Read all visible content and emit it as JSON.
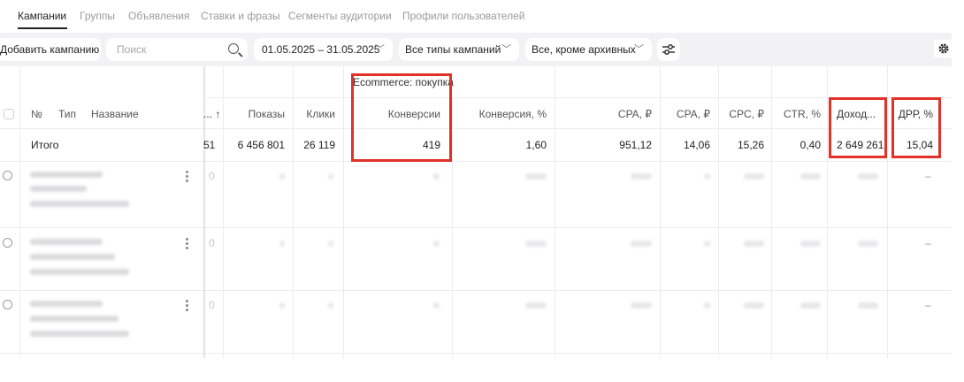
{
  "tabs": [
    {
      "label": "Кампании",
      "active": true
    },
    {
      "label": "Группы",
      "active": false
    },
    {
      "label": "Объявления",
      "active": false
    },
    {
      "label": "Ставки и фразы",
      "active": false
    },
    {
      "label": "Сегменты аудитории",
      "active": false
    },
    {
      "label": "Профили пользователей",
      "active": false
    }
  ],
  "toolbar": {
    "add_campaign_label": "Добавить кампанию",
    "search_placeholder": "Поиск",
    "date_range": "01.05.2025 – 31.05.2025",
    "campaign_type_filter": "Все типы кампаний",
    "archive_filter": "Все, кроме архивных",
    "icons": {
      "search": "search-icon",
      "chevron": "chevron-down-icon",
      "filter": "filter-sliders-icon",
      "settings": "gear-icon"
    }
  },
  "table": {
    "group_header": "Ecommerce: покупка",
    "headers": {
      "number": "№",
      "type": "Тип",
      "name": "Название",
      "sort_col": "... ↑",
      "impressions": "Показы",
      "clicks": "Клики",
      "conversions": "Конверсии",
      "conversion_rate": "Конверсия, %",
      "cpa_rub": "CPA, ₽",
      "cpa_rub_2": "CPA, ₽",
      "cpc": "CPC, ₽",
      "ctr": "CTR, %",
      "revenue": "Доход...",
      "drr": "ДРР, %"
    },
    "total": {
      "label": "Итого",
      "sort_col": "51",
      "impressions": "6 456 801",
      "clicks": "26 119",
      "conversions": "419",
      "conversion_rate": "1,60",
      "cpa_rub": "951,12",
      "cpa_rub_2": "14,06",
      "cpc": "15,26",
      "ctr": "0,40",
      "revenue": "2 649 261,0",
      "drr": "15,04"
    },
    "rows": [
      {
        "sort_col": "0",
        "drr": "–"
      },
      {
        "sort_col": "0",
        "drr": "–"
      },
      {
        "sort_col": "0",
        "drr": "–"
      }
    ]
  },
  "colors": {
    "highlight": "#e03228",
    "toolbar_bg": "#f2f2f5",
    "grid_line": "#ececec"
  }
}
